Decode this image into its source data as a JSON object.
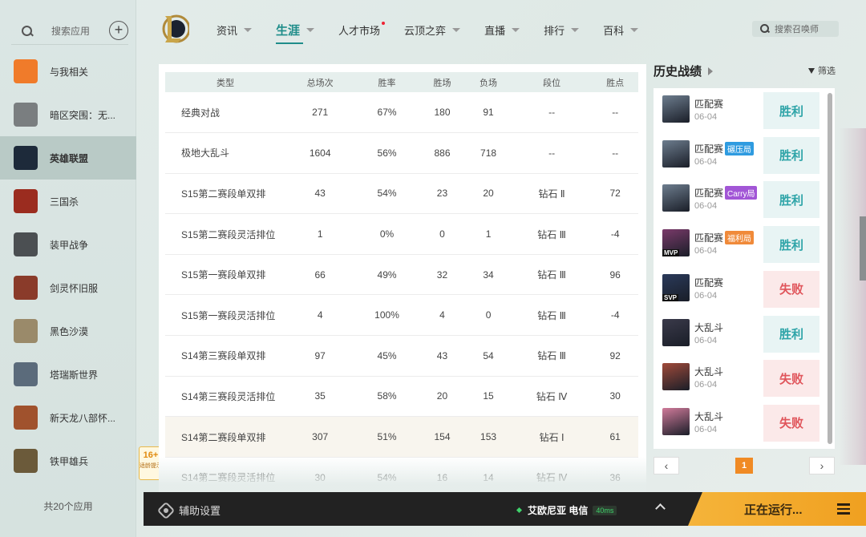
{
  "sidebar": {
    "search_label": "搜索应用",
    "footer": "共20个应用",
    "items": [
      {
        "label": "与我相关",
        "icon": "related-icon",
        "color": "#f07b2a"
      },
      {
        "label": "暗区突围：无...",
        "icon": "game-icon",
        "color": "#7a7e80"
      },
      {
        "label": "英雄联盟",
        "icon": "lol-logo-icon",
        "color": "#1d2a3a"
      },
      {
        "label": "三国杀",
        "icon": "game-icon",
        "color": "#9b2c1f"
      },
      {
        "label": "装甲战争",
        "icon": "game-icon",
        "color": "#4b4f52"
      },
      {
        "label": "剑灵怀旧服",
        "icon": "game-icon",
        "color": "#8a3b2a"
      },
      {
        "label": "黑色沙漠",
        "icon": "game-icon",
        "color": "#9a8a6a"
      },
      {
        "label": "塔瑞斯世界",
        "icon": "game-icon",
        "color": "#5b6b7b"
      },
      {
        "label": "新天龙八部怀...",
        "icon": "game-icon",
        "color": "#a0522d"
      },
      {
        "label": "铁甲雄兵",
        "icon": "game-icon",
        "color": "#6b5a3a"
      }
    ],
    "active_index": 2
  },
  "age_badge": {
    "top": "16+",
    "bottom": "适龄提示"
  },
  "nav": {
    "items": [
      {
        "label": "资讯",
        "chevron": true
      },
      {
        "label": "生涯",
        "chevron": true,
        "active": true
      },
      {
        "label": "人才市场",
        "chevron": false,
        "dot": true
      },
      {
        "label": "云顶之弈",
        "chevron": true
      },
      {
        "label": "直播",
        "chevron": true
      },
      {
        "label": "排行",
        "chevron": true
      },
      {
        "label": "百科",
        "chevron": true
      }
    ],
    "search_placeholder": "搜索召唤师"
  },
  "table": {
    "headers": [
      "类型",
      "总场次",
      "胜率",
      "胜场",
      "负场",
      "段位",
      "胜点"
    ],
    "rows": [
      [
        "经典对战",
        "271",
        "67%",
        "180",
        "91",
        "--",
        "--"
      ],
      [
        "极地大乱斗",
        "1604",
        "56%",
        "886",
        "718",
        "--",
        "--"
      ],
      [
        "S15第二赛段单双排",
        "43",
        "54%",
        "23",
        "20",
        "钻石 Ⅱ",
        "72"
      ],
      [
        "S15第二赛段灵活排位",
        "1",
        "0%",
        "0",
        "1",
        "钻石 Ⅲ",
        "-4"
      ],
      [
        "S15第一赛段单双排",
        "66",
        "49%",
        "32",
        "34",
        "钻石 Ⅲ",
        "96"
      ],
      [
        "S15第一赛段灵活排位",
        "4",
        "100%",
        "4",
        "0",
        "钻石 Ⅲ",
        "-4"
      ],
      [
        "S14第三赛段单双排",
        "97",
        "45%",
        "43",
        "54",
        "钻石 Ⅲ",
        "92"
      ],
      [
        "S14第三赛段灵活排位",
        "35",
        "58%",
        "20",
        "15",
        "钻石 Ⅳ",
        "30"
      ],
      [
        "S14第二赛段单双排",
        "307",
        "51%",
        "154",
        "153",
        "钻石 Ⅰ",
        "61"
      ],
      [
        "S14第二赛段灵活排位",
        "30",
        "54%",
        "16",
        "14",
        "钻石 Ⅳ",
        "36"
      ]
    ],
    "highlight_row": 8
  },
  "history": {
    "title": "历史战绩",
    "filter_label": "筛选",
    "items": [
      {
        "mode": "匹配赛",
        "tag": "",
        "date": "06-04",
        "result": "胜利",
        "win": true,
        "avatar": "#6d7d8e"
      },
      {
        "mode": "匹配赛",
        "tag": "碾压局",
        "tag_color": "#2f9be0",
        "date": "06-04",
        "result": "胜利",
        "win": true,
        "avatar": "#6d7d8e"
      },
      {
        "mode": "匹配赛",
        "tag": "Carry局",
        "tag_color": "#a256d6",
        "date": "06-04",
        "result": "胜利",
        "win": true,
        "avatar": "#6d7d8e"
      },
      {
        "mode": "匹配赛",
        "tag": "福利局",
        "tag_color": "#f08a3a",
        "date": "06-04",
        "result": "胜利",
        "win": true,
        "avatar": "#7a3a6a",
        "badge": "MVP"
      },
      {
        "mode": "匹配赛",
        "tag": "",
        "date": "06-04",
        "result": "失败",
        "win": false,
        "avatar": "#2a3a5a",
        "badge": "SVP"
      },
      {
        "mode": "大乱斗",
        "tag": "",
        "date": "06-04",
        "result": "胜利",
        "win": true,
        "avatar": "#3a3a4a"
      },
      {
        "mode": "大乱斗",
        "tag": "",
        "date": "06-04",
        "result": "失败",
        "win": false,
        "avatar": "#a04a3a"
      },
      {
        "mode": "大乱斗",
        "tag": "",
        "date": "06-04",
        "result": "失败",
        "win": false,
        "avatar": "#d07a9a"
      }
    ],
    "page": "1"
  },
  "bottom": {
    "assist_label": "辅助设置",
    "server": "艾欧尼亚 电信",
    "ping": "40ms",
    "running_label": "正在运行..."
  }
}
